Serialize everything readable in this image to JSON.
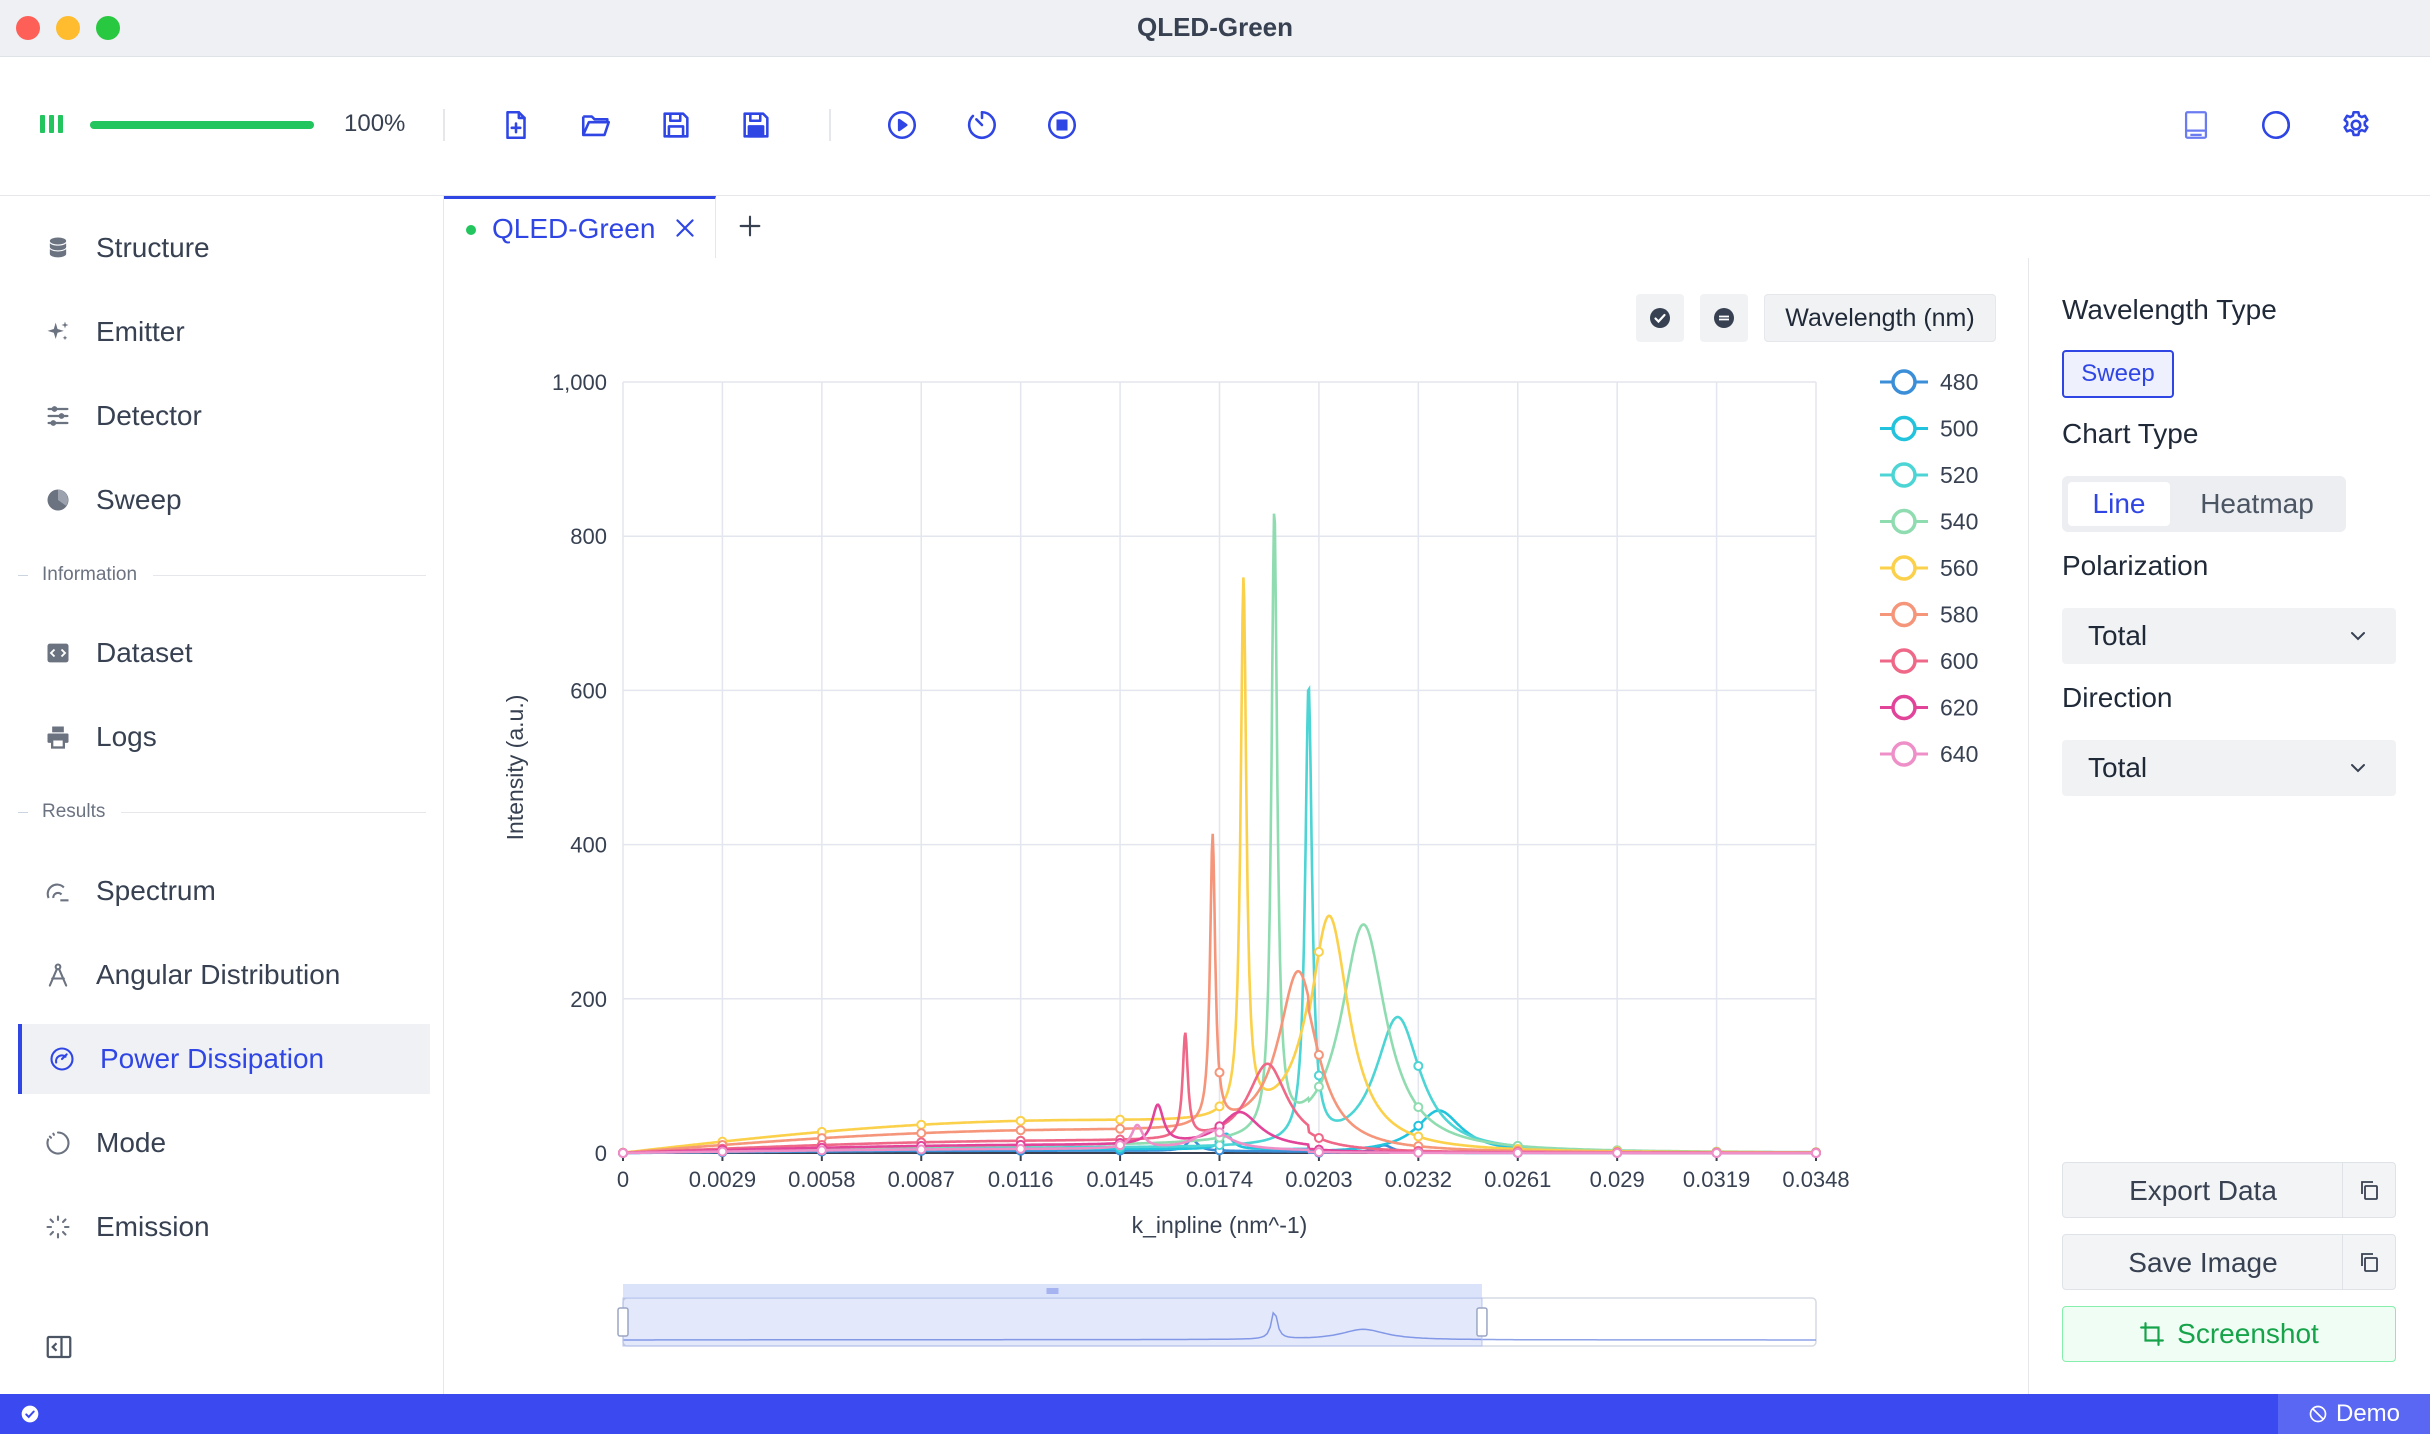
{
  "window": {
    "title": "QLED-Green"
  },
  "toolbar": {
    "progress_value": 100,
    "progress_label": "100%",
    "buttons": [
      "new-file-icon",
      "open-folder-icon",
      "save-icon",
      "save-as-icon",
      "run-icon",
      "timer-icon",
      "stop-icon",
      "book-icon",
      "theme-icon",
      "gear-icon"
    ]
  },
  "sidebar": {
    "items_top": [
      {
        "label": "Structure",
        "icon": "database-icon"
      },
      {
        "label": "Emitter",
        "icon": "sparkles-icon"
      },
      {
        "label": "Detector",
        "icon": "sliders-icon"
      },
      {
        "label": "Sweep",
        "icon": "pie-icon"
      }
    ],
    "section_information": "Information",
    "items_info": [
      {
        "label": "Dataset",
        "icon": "code-icon"
      },
      {
        "label": "Logs",
        "icon": "printer-icon"
      }
    ],
    "section_results": "Results",
    "items_results": [
      {
        "label": "Spectrum",
        "icon": "spectrum-icon"
      },
      {
        "label": "Angular Distribution",
        "icon": "compass-icon"
      },
      {
        "label": "Power Dissipation",
        "icon": "gauge-icon",
        "active": true
      },
      {
        "label": "Mode",
        "icon": "circle-dashed-icon"
      },
      {
        "label": "Emission",
        "icon": "loader-icon"
      }
    ]
  },
  "tabs": [
    {
      "label": "QLED-Green",
      "active": true
    }
  ],
  "chart_toolbar": {
    "wavelength_button": "Wavelength (nm)"
  },
  "right_panel": {
    "wavelength_type_label": "Wavelength Type",
    "wavelength_type_value": "Sweep",
    "chart_type_label": "Chart Type",
    "chart_type_options": [
      "Line",
      "Heatmap"
    ],
    "chart_type_selected": "Line",
    "polarization_label": "Polarization",
    "polarization_value": "Total",
    "direction_label": "Direction",
    "direction_value": "Total",
    "export_label": "Export Data",
    "save_image_label": "Save Image",
    "screenshot_label": "Screenshot"
  },
  "status": {
    "demo_label": "Demo"
  },
  "colors": {
    "accent": "#2f46e5",
    "success": "#22c55e",
    "status_bar": "#3b4af0"
  },
  "chart_data": {
    "type": "line",
    "xlabel": "k_inpline (nm^-1)",
    "ylabel": "Intensity (a.u.)",
    "xlim": [
      0,
      0.0348
    ],
    "ylim": [
      0,
      1000
    ],
    "x_ticks": [
      "0",
      "0.0029",
      "0.0058",
      "0.0087",
      "0.0116",
      "0.0145",
      "0.0174",
      "0.0203",
      "0.0232",
      "0.0261",
      "0.029",
      "0.0319",
      "0.0348"
    ],
    "y_ticks": [
      "0",
      "200",
      "400",
      "600",
      "800",
      "1,000"
    ],
    "grid": true,
    "legend_position": "right",
    "series": [
      {
        "name": "480",
        "color": "#3b8ed8",
        "base": 3,
        "peaks": [
          [
            0.0166,
            15,
            0.0002
          ],
          [
            0.0222,
            10,
            0.0003
          ]
        ]
      },
      {
        "name": "500",
        "color": "#22c3dd",
        "base": 5,
        "peaks": [
          [
            0.0176,
            20,
            0.0002
          ],
          [
            0.0238,
            55,
            0.0008
          ]
        ]
      },
      {
        "name": "520",
        "color": "#4dd4d4",
        "base": 6,
        "peaks": [
          [
            0.02,
            590,
            0.00012
          ],
          [
            0.0226,
            175,
            0.0008
          ]
        ]
      },
      {
        "name": "540",
        "color": "#8fdcb0",
        "base": 8,
        "peaks": [
          [
            0.019,
            805,
            0.0001
          ],
          [
            0.0216,
            295,
            0.0008
          ]
        ]
      },
      {
        "name": "560",
        "color": "#fbd04a",
        "base": 40,
        "peaks": [
          [
            0.0181,
            695,
            0.0001
          ],
          [
            0.0206,
            305,
            0.0007
          ]
        ]
      },
      {
        "name": "580",
        "color": "#f5957a",
        "base": 28,
        "peaks": [
          [
            0.0172,
            375,
            9e-05
          ],
          [
            0.0197,
            218,
            0.0007
          ]
        ]
      },
      {
        "name": "600",
        "color": "#ef6888",
        "base": 15,
        "peaks": [
          [
            0.0164,
            135,
            9e-05
          ],
          [
            0.0188,
            105,
            0.0007
          ]
        ]
      },
      {
        "name": "620",
        "color": "#e2449a",
        "base": 10,
        "peaks": [
          [
            0.0156,
            50,
            0.0002
          ],
          [
            0.018,
            45,
            0.0007
          ]
        ]
      },
      {
        "name": "640",
        "color": "#ef8fc8",
        "base": 5,
        "peaks": [
          [
            0.015,
            30,
            0.0002
          ],
          [
            0.0172,
            25,
            0.0006
          ]
        ]
      }
    ],
    "zoom_range": [
      0,
      0.72
    ]
  }
}
